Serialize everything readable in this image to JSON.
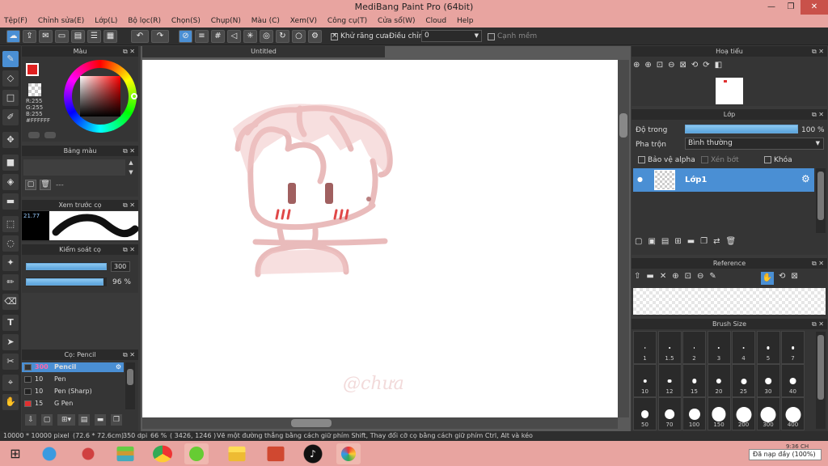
{
  "window": {
    "title": "MediBang Paint Pro (64bit)",
    "minimize": "—",
    "restore": "❐",
    "close": "✕"
  },
  "menu": [
    "Tệp(F)",
    "Chỉnh sửa(E)",
    "Lớp(L)",
    "Bộ lọc(R)",
    "Chọn(S)",
    "Chụp(N)",
    "Màu (C)",
    "Xem(V)",
    "Công cụ(T)",
    "Cửa sổ(W)",
    "Cloud",
    "Help"
  ],
  "toolbar": {
    "antialias_label": "Khử răng cưa",
    "adjust_label": "Điều chỉnh",
    "adjust_value": "0",
    "edge_label": "Cạnh mềm"
  },
  "color_panel": {
    "title": "Màu",
    "r": "R:255",
    "g": "G:255",
    "b": "B:255",
    "hex": "#FFFFFF"
  },
  "palette_panel": {
    "title": "Bảng màu",
    "dashes": "---"
  },
  "brush_preview": {
    "title": "Xem trước cọ",
    "size": "21.77"
  },
  "brush_control": {
    "title": "Kiểm soát cọ",
    "size": "300",
    "opacity": "96 %",
    "size_fill": 1.0,
    "opacity_fill": 0.96
  },
  "brush_list": {
    "title": "Cọ: Pencil",
    "items": [
      {
        "size": "300",
        "name": "Pencil",
        "color": "#333333"
      },
      {
        "size": "10",
        "name": "Pen",
        "color": "#222222"
      },
      {
        "size": "10",
        "name": "Pen (Sharp)",
        "color": "#222222"
      },
      {
        "size": "15",
        "name": "G Pen",
        "color": "#e03030"
      }
    ]
  },
  "document": {
    "tab": "Untitled",
    "watermark": "@chưa"
  },
  "navigator": {
    "title": "Hoạ tiểu"
  },
  "layer_panel": {
    "title": "Lớp",
    "opacity_label": "Độ trong",
    "opacity_value": "100 %",
    "blend_label": "Pha trộn",
    "blend_value": "Bình thường",
    "protect_alpha": "Bảo vệ alpha",
    "clipping": "Xén bớt",
    "lock": "Khóa",
    "layer_name": "Lớp1"
  },
  "reference_panel": {
    "title": "Reference"
  },
  "brush_size_panel": {
    "title": "Brush Size",
    "sizes": [
      "1",
      "1.5",
      "2",
      "3",
      "4",
      "5",
      "7",
      "10",
      "12",
      "15",
      "20",
      "25",
      "30",
      "40",
      "50",
      "70",
      "100",
      "150",
      "200",
      "300",
      "400"
    ]
  },
  "status": {
    "size": "10000 * 10000 pixel",
    "dims": "(72.6 * 72.6cm)",
    "dpi": "350 dpi",
    "zoom": "66 %",
    "coords": "( 3426, 1246 )",
    "hint": "Vẽ một đường thẳng bằng cách giữ phím Shift, Thay đổi cỡ cọ bằng cách giữ phím Ctrl, Alt và kéo"
  },
  "taskbar": {
    "clock": "9:36 CH",
    "battery_tooltip": "Đã nạp đầy (100%)"
  }
}
